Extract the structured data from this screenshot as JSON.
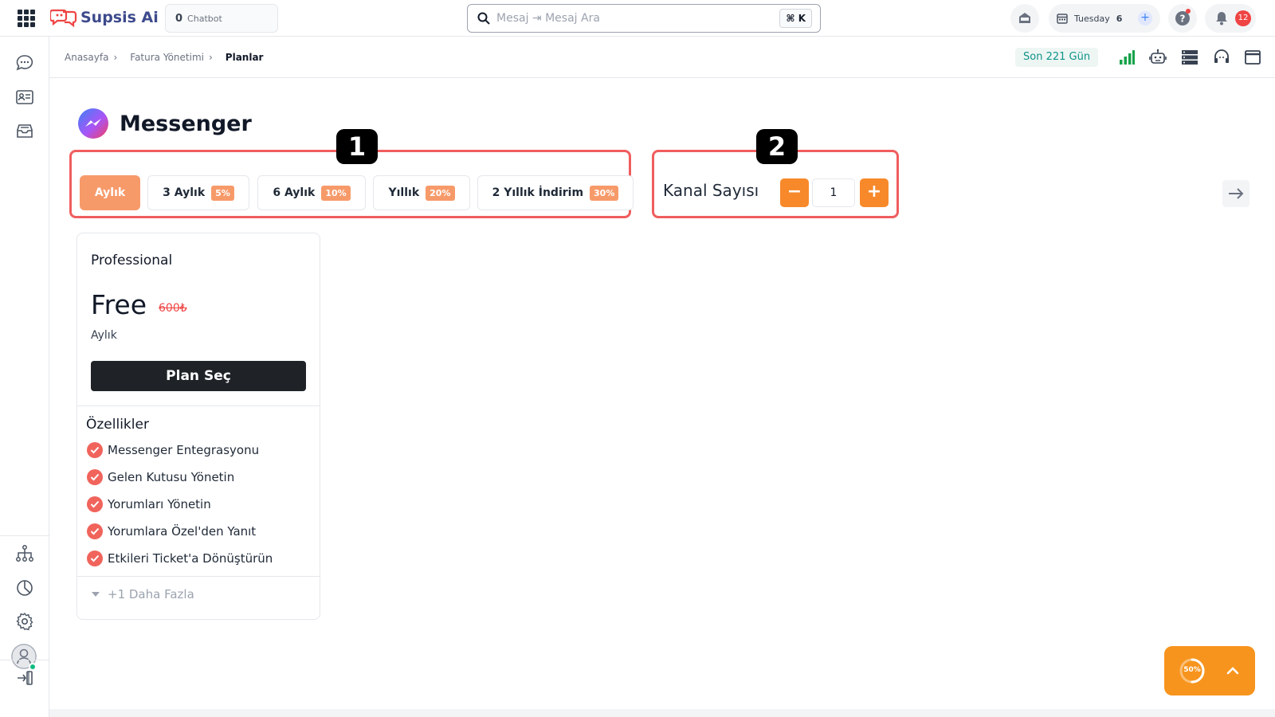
{
  "topbar": {
    "brand": "Supsis Ai",
    "chatbot_count": "0",
    "chatbot_label": "Chatbot",
    "search_placeholder": "Mesaj ⇥ Mesaj Ara",
    "search_shortcut": "⌘ K",
    "date_weekday": "Tuesday",
    "date_day": "6",
    "date_plus": "+",
    "notification_count": "12"
  },
  "breadcrumb": {
    "items": [
      "Anasayfa",
      "Fatura Yönetimi",
      "Planlar"
    ],
    "separator": "›",
    "days_badge": "Son 221 Gün"
  },
  "page": {
    "title": "Messenger",
    "highlight_1": "1",
    "highlight_2": "2"
  },
  "periods": [
    {
      "label": "Aylık",
      "discount": "",
      "active": true
    },
    {
      "label": "3 Aylık",
      "discount": "5%",
      "active": false
    },
    {
      "label": "6 Aylık",
      "discount": "10%",
      "active": false
    },
    {
      "label": "Yıllık",
      "discount": "20%",
      "active": false
    },
    {
      "label": "2 Yıllık İndirim",
      "discount": "30%",
      "active": false
    }
  ],
  "channel": {
    "label": "Kanal Sayısı",
    "value": "1",
    "minus": "−",
    "plus": "+"
  },
  "plan": {
    "name": "Professional",
    "price": "Free",
    "old_price": "600₺",
    "period": "Aylık",
    "button": "Plan Seç",
    "features_title": "Özellikler",
    "features": [
      "Messenger Entegrasyonu",
      "Gelen Kutusu Yönetin",
      "Yorumları Yönetin",
      "Yorumlara Özel'den Yanıt",
      "Etkileri Ticket'a Dönüştürün"
    ],
    "more": "+1 Daha Fazla"
  },
  "widget": {
    "progress": "50%",
    "progress_fraction": 0.5
  },
  "colors": {
    "accent_orange": "#f7892b",
    "highlight_red": "#f05d5e",
    "active_tab": "#f79a6a",
    "teal": "#0d9488"
  }
}
